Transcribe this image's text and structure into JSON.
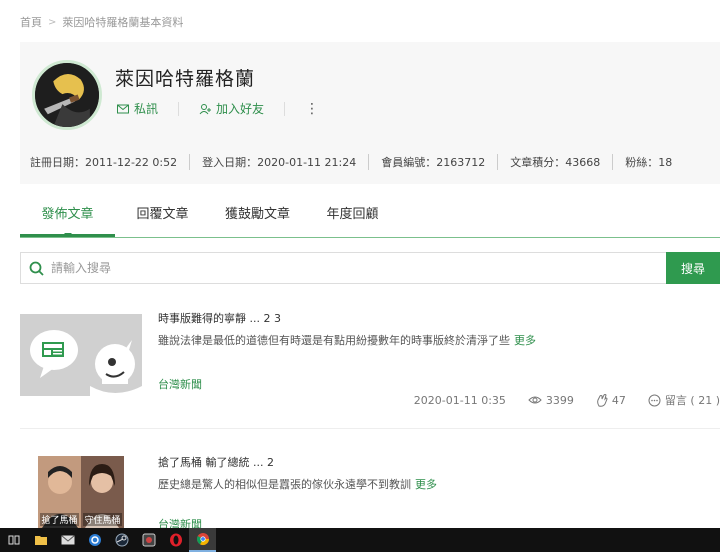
{
  "breadcrumb": {
    "home": "首頁",
    "separator": ">",
    "current": "萊因哈特羅格蘭基本資料"
  },
  "profile": {
    "name": "萊因哈特羅格蘭",
    "message_label": "私訊",
    "add_friend_label": "加入好友",
    "more_label": "⋮",
    "stats": [
      "註冊日期：2011-12-22 0:52",
      "登入日期：2020-01-11 21:24",
      "會員編號：2163712",
      "文章積分：43668",
      "粉絲：18"
    ]
  },
  "tabs": [
    {
      "label": "發佈文章",
      "active": true
    },
    {
      "label": "回覆文章",
      "active": false
    },
    {
      "label": "獲鼓勵文章",
      "active": false
    },
    {
      "label": "年度回顧",
      "active": false
    }
  ],
  "search": {
    "placeholder": "請輸入搜尋",
    "button_label": "搜尋"
  },
  "articles": [
    {
      "title": "時事版難得的寧靜 ... 2 3",
      "summary": "雖說法律是最低的道德但有時還是有點用紛擾數年的時事版終於清淨了些",
      "more": "更多",
      "category": "台灣新聞",
      "date": "2020-01-11 0:35",
      "views": "3399",
      "likes": "47",
      "comments": "留言 ( 21 )"
    },
    {
      "title": "搶了馬桶 輸了總統 ... 2",
      "summary": "歷史總是驚人的相似但是囂張的傢伙永遠學不到教訓",
      "more": "更多",
      "category": "台灣新聞",
      "thumb_captions": [
        "搶了馬桶",
        "守住馬桶"
      ]
    }
  ],
  "colors": {
    "accent": "#2f8f4c",
    "search_button": "#2f9a4f",
    "profile_bg": "#f7f7f7",
    "taskbar": "#111111"
  },
  "taskbar": {
    "icons": [
      "task-view-icon",
      "file-explorer-icon",
      "mail-icon",
      "browser-blue-icon",
      "steam-icon",
      "media-icon",
      "opera-icon",
      "chrome-icon"
    ]
  }
}
